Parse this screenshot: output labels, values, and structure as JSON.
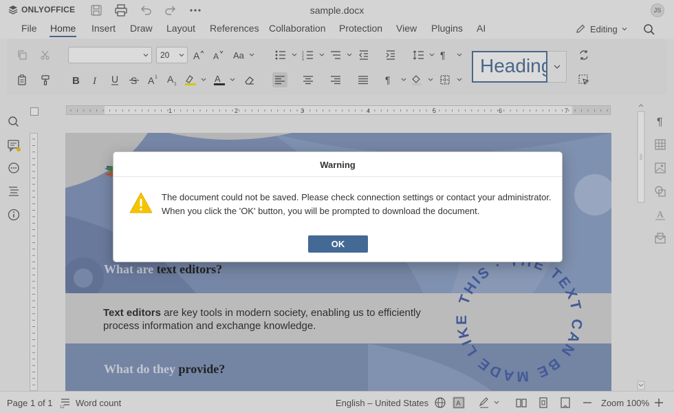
{
  "app": {
    "name": "ONLYOFFICE",
    "document_title": "sample.docx",
    "user_initials": "JS"
  },
  "menu": {
    "tabs": [
      {
        "label": "File"
      },
      {
        "label": "Home"
      },
      {
        "label": "Insert"
      },
      {
        "label": "Draw"
      },
      {
        "label": "Layout"
      },
      {
        "label": "References"
      },
      {
        "label": "Collaboration"
      },
      {
        "label": "Protection"
      },
      {
        "label": "View"
      },
      {
        "label": "Plugins"
      },
      {
        "label": "AI"
      }
    ],
    "active_tab": "Home",
    "mode": "Editing"
  },
  "toolbar": {
    "font_name": "",
    "font_size": "20",
    "style_preview": "Heading"
  },
  "document": {
    "heading1_part1": "What are ",
    "heading1_part2": "text editors?",
    "body_bold": "Text editors",
    "body_rest": " are key tools in modern society, enabling us to efficiently process information and exchange knowledge.",
    "heading2_part1": "What do they ",
    "heading2_part2": "provide?",
    "curved_text": "THIS · THE TEXT CAN BE MADE LIKE"
  },
  "ruler": {
    "numbers": [
      "1",
      "2",
      "3",
      "4",
      "5",
      "6",
      "7"
    ]
  },
  "dialog": {
    "title": "Warning",
    "message_line1": "The document could not be saved. Please check connection settings or contact your administrator.",
    "message_line2": "When you click the 'OK' button, you will be prompted to download the document.",
    "ok_label": "OK"
  },
  "status": {
    "page": "Page 1 of 1",
    "word_count": "Word count",
    "language": "English – United States",
    "zoom": "Zoom 100%"
  },
  "colors": {
    "accent": "#446995",
    "warning": "#f5c400",
    "orange_text": "#c86a3a"
  }
}
